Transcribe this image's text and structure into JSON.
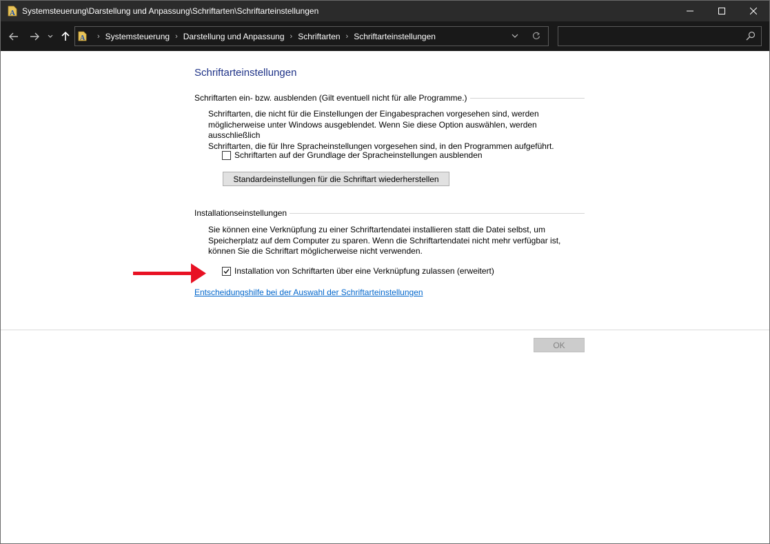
{
  "window": {
    "title": "Systemsteuerung\\Darstellung und Anpassung\\Schriftarten\\Schriftarteinstellungen",
    "icon": "fonts-folder-icon"
  },
  "navigation": {
    "breadcrumbs": [
      "Systemsteuerung",
      "Darstellung und Anpassung",
      "Schriftarten",
      "Schriftarteinstellungen"
    ],
    "search_value": ""
  },
  "content": {
    "page_title": "Schriftarteinstellungen",
    "section1": {
      "header": "Schriftarten ein- bzw. ausblenden (Gilt eventuell nicht für alle Programme.)",
      "description_lines": [
        "Schriftarten, die nicht für die Einstellungen der Eingabesprachen vorgesehen sind, werden",
        "möglicherweise unter Windows ausgeblendet. Wenn Sie diese Option auswählen, werden ausschließlich",
        "Schriftarten, die für Ihre Spracheinstellungen vorgesehen sind, in den Programmen aufgeführt."
      ],
      "checkbox_label": "Schriftarten auf der Grundlage der Spracheinstellungen ausblenden",
      "checkbox_checked": false,
      "restore_button": "Standardeinstellungen für die Schriftart wiederherstellen"
    },
    "section2": {
      "header": "Installationseinstellungen",
      "description_lines": [
        "Sie können eine Verknüpfung zu einer Schriftartendatei installieren statt die Datei selbst, um",
        "Speicherplatz auf dem Computer zu sparen. Wenn die Schriftartendatei nicht mehr verfügbar ist,",
        "können Sie die Schriftart möglicherweise nicht verwenden."
      ],
      "checkbox_label": "Installation von Schriftarten über eine Verknüpfung zulassen (erweitert)",
      "checkbox_checked": true
    },
    "help_link": "Entscheidungshilfe bei der Auswahl der Schriftarteinstellungen",
    "ok_button": "OK"
  },
  "colors": {
    "titlebar": "#2b2b2b",
    "navbar": "#191919",
    "page_title": "#1e3287",
    "link": "#0066cc",
    "arrow": "#e81123"
  }
}
